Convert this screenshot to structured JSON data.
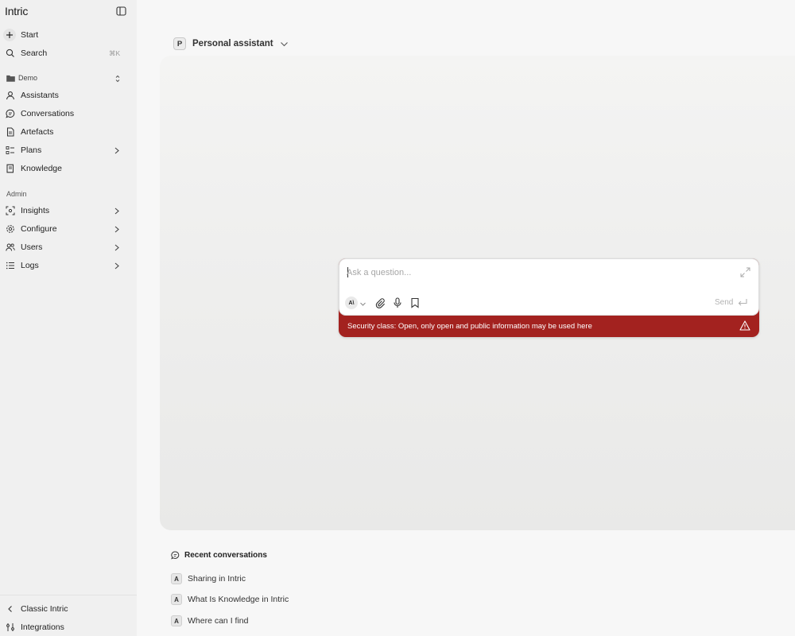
{
  "app": {
    "title": "Intric"
  },
  "sidebar": {
    "start_label": "Start",
    "search_label": "Search",
    "search_shortcut": "⌘K",
    "space_name": "Demo",
    "space_items": [
      {
        "label": "Assistants",
        "icon": "assistants-icon"
      },
      {
        "label": "Conversations",
        "icon": "conversations-icon"
      },
      {
        "label": "Artefacts",
        "icon": "artefacts-icon"
      },
      {
        "label": "Plans",
        "icon": "plans-icon"
      },
      {
        "label": "Knowledge",
        "icon": "knowledge-icon"
      }
    ],
    "admin_label": "Admin",
    "admin_items": [
      {
        "label": "Insights",
        "icon": "insights-icon"
      },
      {
        "label": "Configure",
        "icon": "configure-icon"
      },
      {
        "label": "Users",
        "icon": "users-icon"
      },
      {
        "label": "Logs",
        "icon": "logs-icon"
      }
    ],
    "footer": {
      "classic_label": "Classic Intric",
      "integrations_label": "Integrations"
    }
  },
  "assistant": {
    "avatar_letter": "P",
    "name": "Personal assistant"
  },
  "composer": {
    "placeholder": "Ask a question...",
    "value": "",
    "model_badge": "A\\",
    "send_label": "Send",
    "security_text": "Security class: Open, only open and public information may be used here"
  },
  "recent": {
    "title": "Recent conversations",
    "items": [
      {
        "avatar_letter": "A",
        "label": "Sharing in Intric"
      },
      {
        "avatar_letter": "A",
        "label": "What Is Knowledge in Intric"
      },
      {
        "avatar_letter": "A",
        "label": "Where can I find"
      }
    ]
  },
  "colors": {
    "security_banner": "#a3221f",
    "sidebar_bg": "#f0f0f0",
    "page_bg": "#f7f7f7"
  }
}
